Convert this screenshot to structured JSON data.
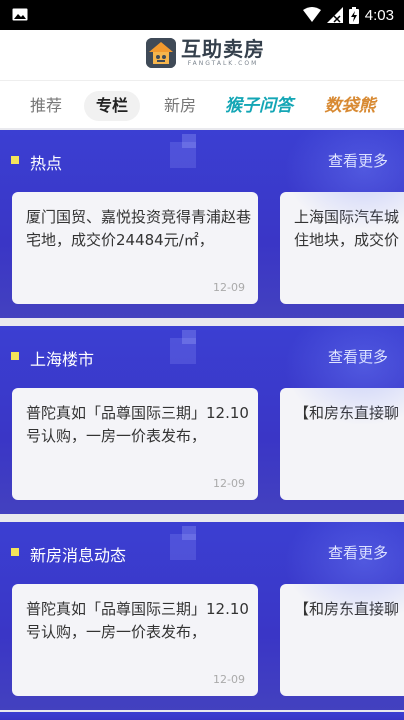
{
  "status": {
    "time": "4:03"
  },
  "app": {
    "name": "互助卖房",
    "sub": "FANGTALK.COM"
  },
  "tabs": [
    {
      "label": "推荐"
    },
    {
      "label": "专栏"
    },
    {
      "label": "新房"
    },
    {
      "label": "猴子问答"
    },
    {
      "label": "数袋熊"
    }
  ],
  "sections": [
    {
      "title": "热点",
      "more": "查看更多",
      "cards": [
        {
          "title": "厦门国贸、嘉悦投资竞得青浦赵巷宅地，成交价24484元/㎡，",
          "date": "12-09"
        },
        {
          "title": "上海国际汽车城",
          "title2": "住地块，成交价"
        }
      ]
    },
    {
      "title": "上海楼市",
      "more": "查看更多",
      "cards": [
        {
          "title": "普陀真如「品尊国际三期」12.10号认购，一房一价表发布，",
          "date": "12-09"
        },
        {
          "title": "【和房东直接聊"
        }
      ]
    },
    {
      "title": "新房消息动态",
      "more": "查看更多",
      "cards": [
        {
          "title": "普陀真如「品尊国际三期」12.10号认购，一房一价表发布，",
          "date": "12-09"
        },
        {
          "title": "【和房东直接聊"
        }
      ]
    }
  ]
}
